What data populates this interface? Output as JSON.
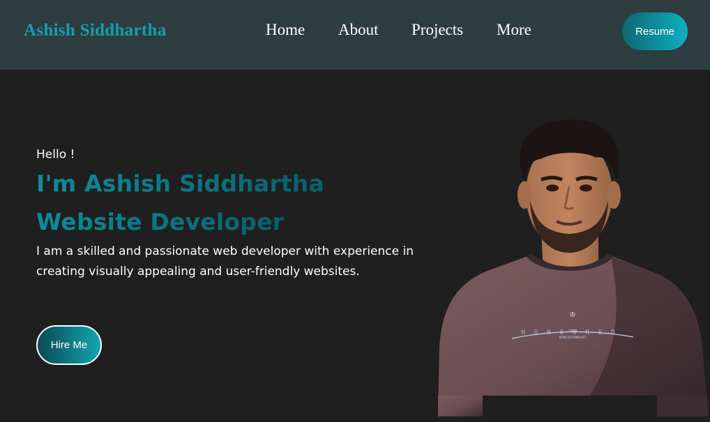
{
  "header": {
    "brand": "Ashish Siddhartha",
    "nav": [
      {
        "label": "Home"
      },
      {
        "label": "About"
      },
      {
        "label": "Projects"
      },
      {
        "label": "More"
      }
    ],
    "resume_label": "Resume"
  },
  "hero": {
    "greeting": "Hello !",
    "name_line": "I'm Ashish Siddhartha",
    "role_line": "Website Developer",
    "description": "I am a skilled and passionate web developer with experience in creating visually appealing and user-friendly websites.",
    "hire_label": "Hire Me",
    "shirt_text": "HONOURED",
    "shirt_subtext": "1900",
    "shirt_small": "BOKLESTANDUST"
  },
  "colors": {
    "navbar_bg": "#2e3d40",
    "page_bg": "#1f1f1f",
    "accent": "#13a0ae",
    "accent_dark": "#0a5e6a"
  }
}
